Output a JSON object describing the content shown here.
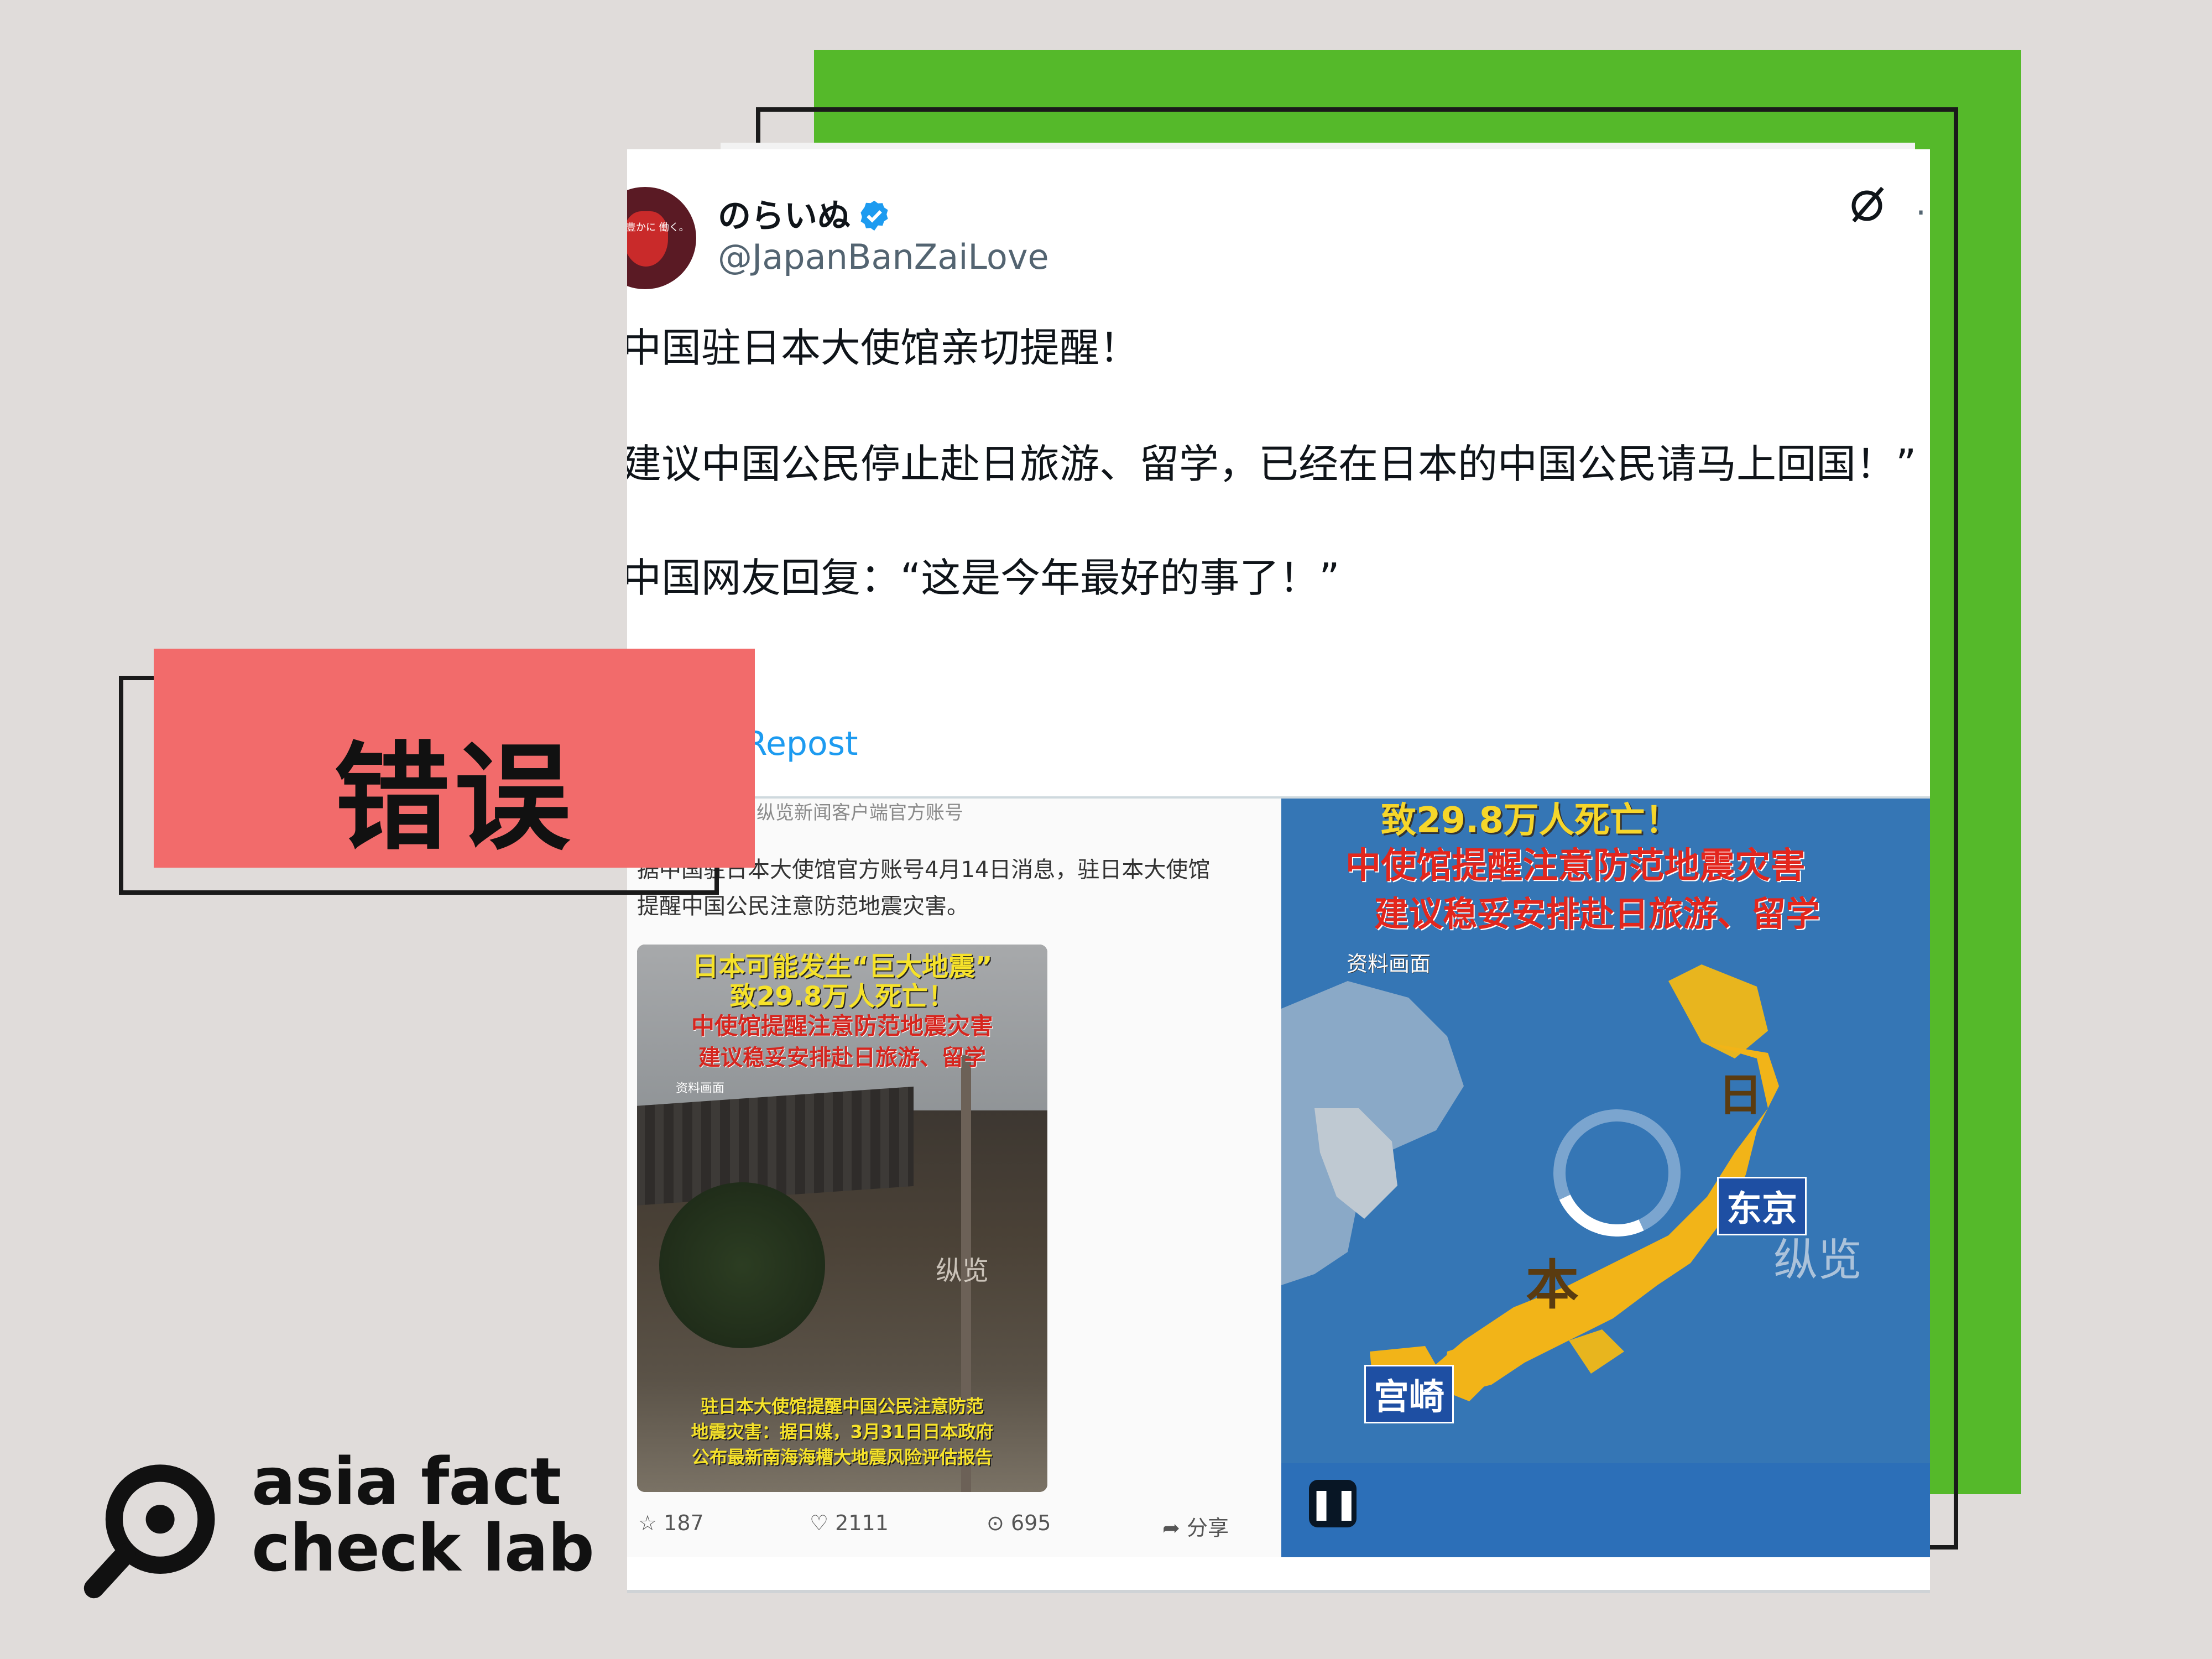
{
  "colors": {
    "background": "#e0dcda",
    "green_panel": "#55b92a",
    "verdict_bg": "#f26b6b",
    "link_blue": "#1d9bf0"
  },
  "verdict": {
    "label": "错误"
  },
  "tweet": {
    "display_name": "のらいぬ",
    "handle": "@JapanBanZaiLove",
    "avatar_text": "日本を豊かに 働く。",
    "lines": [
      "中国驻日本大使馆亲切提醒！",
      "建议中国公民停止赴日旅游、留学，已经在日本的中国公民请马上回国！”",
      "中国网友回复：“这是今年最好的事了！”"
    ],
    "repost_text": "Repost",
    "icons": {
      "verified": "verified-badge-icon",
      "grok": "slash-circle-icon",
      "more": "more-dots-icon"
    }
  },
  "left_screenshot": {
    "source_line": "纵览新闻客户端官方账号",
    "news_line_1": "据中国驻日本大使馆官方账号4月14日消息，驻日本大使馆",
    "news_line_2": "提醒中国公民注意防范地震灾害。",
    "thumbnail": {
      "yellow_1": "日本可能发生“巨大地震”",
      "yellow_2": "致29.8万人死亡！",
      "red_1": "中使馆提醒注意防范地震灾害",
      "red_2": "建议稳妥安排赴日旅游、留学",
      "ref": "资料画面",
      "watermark": "纵览",
      "bottom_1": "驻日本大使馆提醒中国公民注意防范",
      "bottom_2": "地震灾害：据日媒，3月31日日本政府",
      "bottom_3": "公布最新南海海槽大地震风险评估报告"
    },
    "actions": {
      "star": "187",
      "like": "2111",
      "comment": "695",
      "share": "分享"
    }
  },
  "video": {
    "yellow_1": "致29.8万人死亡！",
    "red_1": "中使馆提醒注意防范地震灾害",
    "red_2": "建议稳妥安排赴日旅游、留学",
    "ref": "资料画面",
    "map_label_ri": "日",
    "map_label_ben": "本",
    "city_tokyo": "东京",
    "city_miyazaki": "宫崎",
    "watermark": "纵览",
    "pause_icon": "pause-icon"
  },
  "logo": {
    "line_1": "asia fact",
    "line_2": "check lab"
  }
}
